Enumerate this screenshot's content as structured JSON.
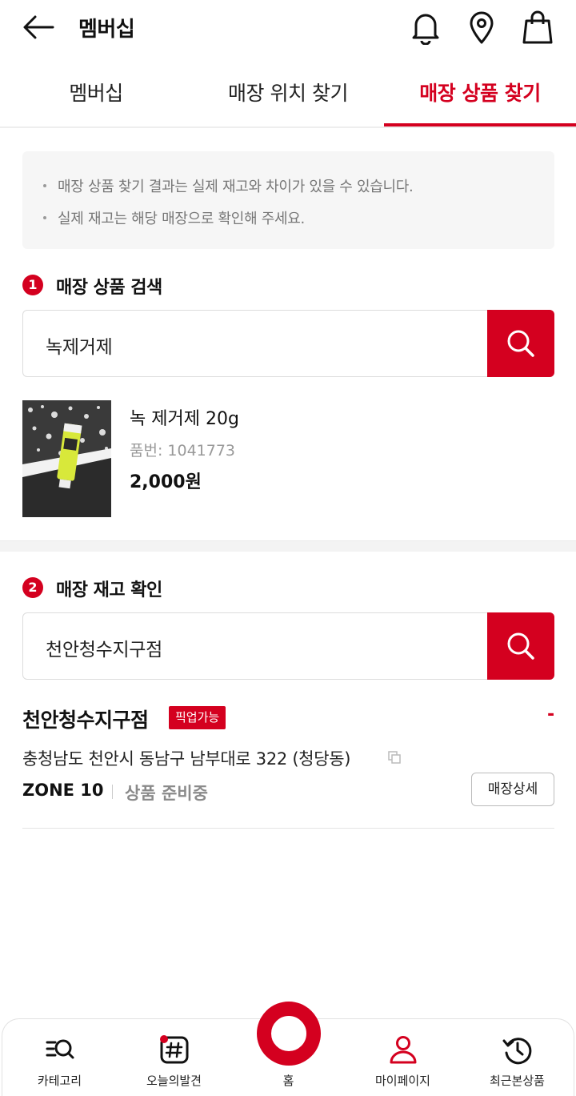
{
  "header": {
    "title": "멤버십",
    "back_icon": "arrow-left-icon",
    "icons": [
      "bell-icon",
      "location-pin-icon",
      "shopping-bag-icon"
    ]
  },
  "tabs": [
    {
      "label": "멤버십",
      "active": false
    },
    {
      "label": "매장 위치 찾기",
      "active": false
    },
    {
      "label": "매장 상품 찾기",
      "active": true
    }
  ],
  "notice": [
    "매장 상품 찾기 결과는 실제 재고와 차이가 있을 수 있습니다.",
    "실제 재고는 해당 매장으로 확인해 주세요."
  ],
  "product_search": {
    "step": "1",
    "title": "매장 상품 검색",
    "value": "녹제거제"
  },
  "product": {
    "name": "녹 제거제 20g",
    "code": "품번: 1041773",
    "price": "2,000원"
  },
  "stock_check": {
    "step": "2",
    "title": "매장 재고 확인",
    "value": "천안청수지구점"
  },
  "store": {
    "name": "천안청수지구점",
    "badge": "픽업가능",
    "stock_mark": "-",
    "address": "충청남도 천안시 동남구 남부대로 322 (청당동)",
    "zone": "ZONE 10",
    "stock_status": "상품 준비중",
    "detail_button": "매장상세"
  },
  "bottom_nav": [
    {
      "label": "카테고리",
      "icon": "category-search-icon"
    },
    {
      "label": "오늘의발견",
      "icon": "hashtag-icon"
    },
    {
      "label": "홈",
      "icon": "home-ring-icon"
    },
    {
      "label": "마이페이지",
      "icon": "person-icon"
    },
    {
      "label": "최근본상품",
      "icon": "history-icon"
    }
  ],
  "colors": {
    "accent": "#d4001f",
    "notice_bg": "#f6f6f6",
    "muted_text": "#8a8a8a"
  }
}
